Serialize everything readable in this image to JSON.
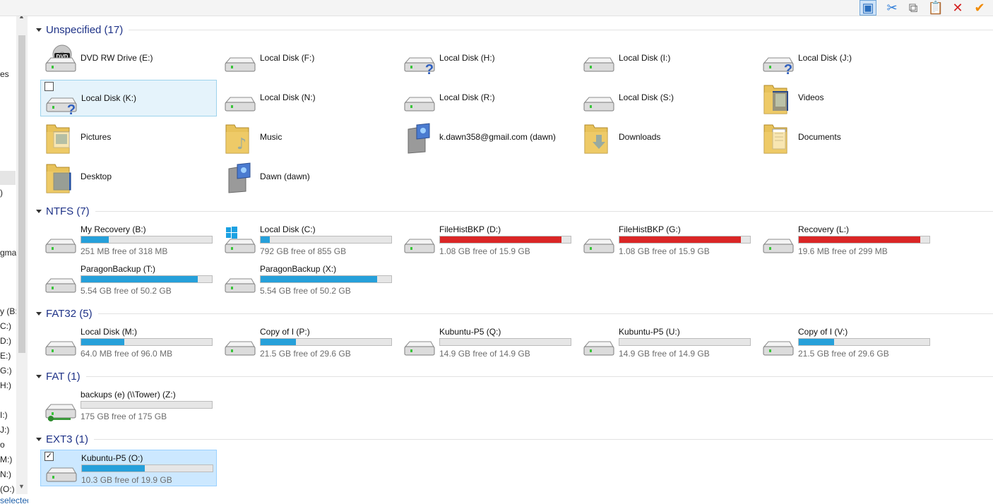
{
  "sidebar": {
    "fragments": [
      "es",
      ")",
      "gma",
      "y (B:)",
      "C:)",
      "D:)",
      "E:)",
      "G:)",
      "H:)",
      "I:)",
      "J:)",
      "o",
      "M:)",
      "N:)",
      "(O:)"
    ],
    "status": "selected"
  },
  "toolbar": {
    "buttons": [
      {
        "icon": "details-pane-icon",
        "glyph": "▣",
        "color": "#2a6fbf",
        "active": true
      },
      {
        "icon": "cut-icon",
        "glyph": "✂",
        "color": "#2a7ad8"
      },
      {
        "icon": "copy-icon",
        "glyph": "⧉",
        "color": "#777777"
      },
      {
        "icon": "paste-icon",
        "glyph": "📋",
        "color": "#a57a2a"
      },
      {
        "icon": "delete-icon",
        "glyph": "✕",
        "color": "#d42020"
      },
      {
        "icon": "properties-icon",
        "glyph": "✔",
        "color": "#f08a00"
      }
    ]
  },
  "groups": [
    {
      "title": "Unspecified (17)",
      "items": [
        {
          "name": "DVD RW Drive (E:)",
          "icon": "dvd-drive-icon"
        },
        {
          "name": "Local Disk (F:)",
          "icon": "drive-icon"
        },
        {
          "name": "Local Disk (H:)",
          "icon": "drive-unknown-icon"
        },
        {
          "name": "Local Disk (I:)",
          "icon": "drive-icon"
        },
        {
          "name": "Local Disk (J:)",
          "icon": "drive-unknown-icon"
        },
        {
          "name": "Local Disk (K:)",
          "icon": "drive-unknown-icon",
          "state": "focused",
          "checkbox": true,
          "checked": false
        },
        {
          "name": "Local Disk (N:)",
          "icon": "drive-icon"
        },
        {
          "name": "Local Disk (R:)",
          "icon": "drive-icon"
        },
        {
          "name": "Local Disk (S:)",
          "icon": "drive-icon"
        },
        {
          "name": "Videos",
          "icon": "videos-folder-icon"
        },
        {
          "name": "Pictures",
          "icon": "pictures-folder-icon"
        },
        {
          "name": "Music",
          "icon": "music-folder-icon"
        },
        {
          "name": "k.dawn358@gmail.com (dawn)",
          "icon": "user-folder-icon"
        },
        {
          "name": "Downloads",
          "icon": "downloads-folder-icon"
        },
        {
          "name": "Documents",
          "icon": "documents-folder-icon"
        },
        {
          "name": "Desktop",
          "icon": "desktop-folder-icon"
        },
        {
          "name": "Dawn (dawn)",
          "icon": "user-folder-icon"
        }
      ]
    },
    {
      "title": "NTFS (7)",
      "items": [
        {
          "name": "My Recovery (B:)",
          "icon": "drive-icon",
          "free": "251 MB free of 318 MB",
          "used_fraction": 0.21,
          "color": "#26a0da"
        },
        {
          "name": "Local Disk (C:)",
          "icon": "windows-drive-icon",
          "free": "792 GB free of 855 GB",
          "used_fraction": 0.07,
          "color": "#26a0da"
        },
        {
          "name": "FileHistBKP (D:)",
          "icon": "drive-icon",
          "free": "1.08 GB free of 15.9 GB",
          "used_fraction": 0.93,
          "color": "#da2626"
        },
        {
          "name": "FileHistBKP (G:)",
          "icon": "drive-icon",
          "free": "1.08 GB free of 15.9 GB",
          "used_fraction": 0.93,
          "color": "#da2626"
        },
        {
          "name": "Recovery (L:)",
          "icon": "drive-icon",
          "free": "19.6 MB free of 299 MB",
          "used_fraction": 0.93,
          "color": "#da2626"
        },
        {
          "name": "ParagonBackup (T:)",
          "icon": "drive-icon",
          "free": "5.54 GB free of 50.2 GB",
          "used_fraction": 0.89,
          "color": "#26a0da"
        },
        {
          "name": "ParagonBackup (X:)",
          "icon": "drive-icon",
          "free": "5.54 GB free of 50.2 GB",
          "used_fraction": 0.89,
          "color": "#26a0da"
        }
      ]
    },
    {
      "title": "FAT32 (5)",
      "items": [
        {
          "name": "Local Disk (M:)",
          "icon": "drive-icon",
          "free": "64.0 MB free of 96.0 MB",
          "used_fraction": 0.33,
          "color": "#26a0da"
        },
        {
          "name": "Copy of I (P:)",
          "icon": "drive-icon",
          "free": "21.5 GB free of 29.6 GB",
          "used_fraction": 0.27,
          "color": "#26a0da"
        },
        {
          "name": "Kubuntu-P5 (Q:)",
          "icon": "drive-icon",
          "free": "14.9 GB free of 14.9 GB",
          "used_fraction": 0.0,
          "color": "#26a0da"
        },
        {
          "name": "Kubuntu-P5 (U:)",
          "icon": "drive-icon",
          "free": "14.9 GB free of 14.9 GB",
          "used_fraction": 0.0,
          "color": "#26a0da"
        },
        {
          "name": "Copy of I (V:)",
          "icon": "drive-icon",
          "free": "21.5 GB free of 29.6 GB",
          "used_fraction": 0.27,
          "color": "#26a0da"
        }
      ]
    },
    {
      "title": "FAT (1)",
      "items": [
        {
          "name": "backups (e) (\\\\Tower) (Z:)",
          "icon": "network-drive-icon",
          "free": "175 GB free of 175 GB",
          "used_fraction": 0.0,
          "color": "#26a0da"
        }
      ]
    },
    {
      "title": "EXT3 (1)",
      "items": [
        {
          "name": "Kubuntu-P5 (O:)",
          "icon": "drive-icon",
          "free": "10.3 GB free of 19.9 GB",
          "used_fraction": 0.48,
          "color": "#26a0da",
          "state": "selected",
          "checkbox": true,
          "checked": true
        }
      ]
    }
  ]
}
